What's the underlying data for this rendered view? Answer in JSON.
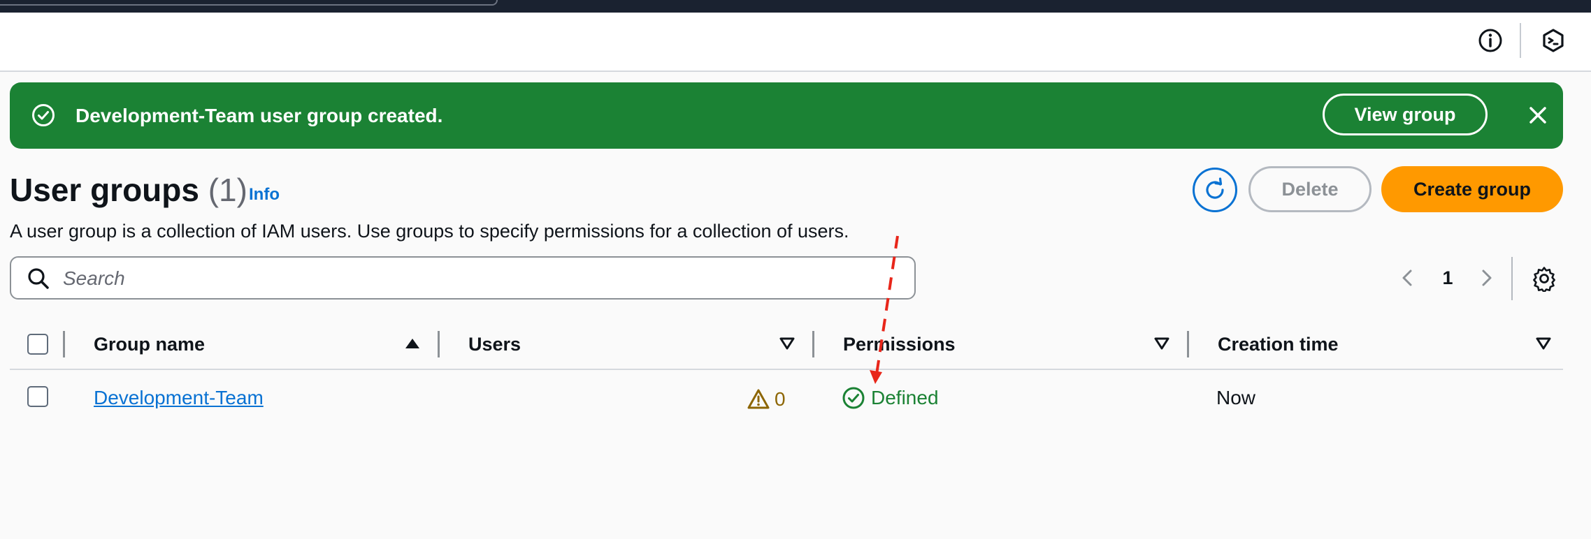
{
  "header": {
    "icons": [
      "info-icon",
      "cloudshell-icon"
    ]
  },
  "flash": {
    "message": "Development-Team user group created.",
    "view_label": "View group",
    "color": "#1b8234"
  },
  "page": {
    "title": "User groups",
    "count": "(1)",
    "info_label": "Info",
    "description": "A user group is a collection of IAM users. Use groups to specify permissions for a collection of users."
  },
  "actions": {
    "delete_label": "Delete",
    "create_label": "Create group",
    "accent": "#ff9900"
  },
  "search": {
    "placeholder": "Search",
    "value": ""
  },
  "pagination": {
    "current_page": "1"
  },
  "table": {
    "columns": [
      "Group name",
      "Users",
      "Permissions",
      "Creation time"
    ],
    "rows": [
      {
        "group_name": "Development-Team",
        "users": "0",
        "permissions": "Defined",
        "creation_time": "Now"
      }
    ]
  }
}
